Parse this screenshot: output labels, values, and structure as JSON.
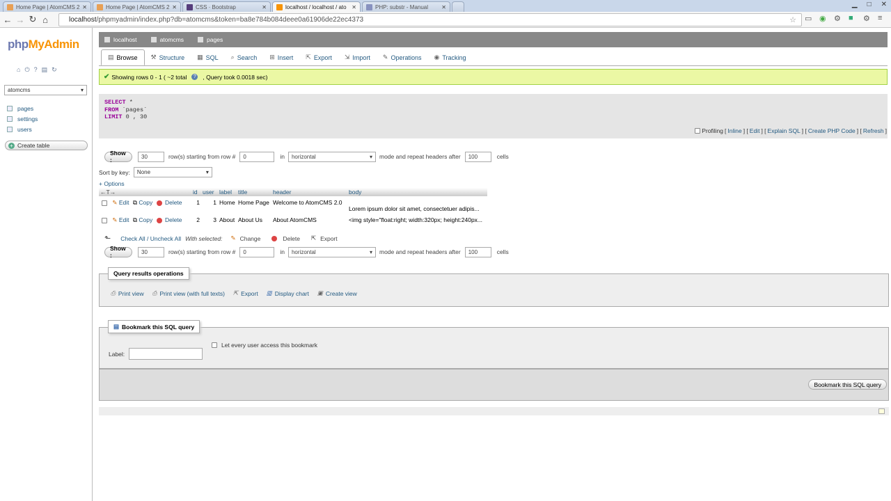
{
  "browser": {
    "tabs": [
      {
        "title": "Home Page | AtomCMS 2.",
        "favicon_color": "#e8a055",
        "active": false
      },
      {
        "title": "Home Page | AtomCMS 2.",
        "favicon_color": "#e8a055",
        "active": false
      },
      {
        "title": "CSS · Bootstrap",
        "favicon_color": "#563d7c",
        "active": false
      },
      {
        "title": "localhost / localhost / ato",
        "favicon_color": "#f89406",
        "active": true
      },
      {
        "title": "PHP: substr - Manual",
        "favicon_color": "#8892bf",
        "active": false
      }
    ],
    "url_host": "localhost",
    "url_rest": "/phpmyadmin/index.php?db=atomcms&token=ba8e784b084deee0a61906de22ec4373"
  },
  "sidebar": {
    "logo_php": "php",
    "logo_my": "MyAdmin",
    "db_selected": "atomcms",
    "tables": [
      "pages",
      "settings",
      "users"
    ],
    "create_table": "Create table"
  },
  "breadcrumb": {
    "server": "localhost",
    "db": "atomcms",
    "table": "pages"
  },
  "tabs": [
    "Browse",
    "Structure",
    "SQL",
    "Search",
    "Insert",
    "Export",
    "Import",
    "Operations",
    "Tracking"
  ],
  "success": {
    "text": "Showing rows 0 - 1 ( ~2 total",
    "query_time": ", Query took 0.0018 sec)"
  },
  "sql": {
    "select_kw": "SELECT",
    "select_val": " *",
    "from_kw": "FROM",
    "from_val": " `pages`",
    "limit_kw": "LIMIT",
    "limit_val": " 0 , 30"
  },
  "profiling": {
    "label": "Profiling",
    "links": [
      "Inline",
      "Edit",
      "Explain SQL",
      "Create PHP Code",
      "Refresh"
    ]
  },
  "nav": {
    "show": "Show :",
    "rows": "30",
    "rows_text": "row(s) starting from row #",
    "start": "0",
    "in": "in",
    "mode": "horizontal",
    "mode_text": "mode and repeat headers after",
    "repeat": "100",
    "cells": "cells"
  },
  "sort": {
    "label": "Sort by key:",
    "value": "None"
  },
  "options": "+ Options",
  "table": {
    "columns": [
      "id",
      "user",
      "label",
      "title",
      "header",
      "body"
    ],
    "rows": [
      {
        "id": "1",
        "user": "1",
        "label": "Home",
        "title": "Home Page",
        "header": "Welcome to AtomCMS 2.0",
        "body": "Lorem ipsum dolor sit amet, consectetuer adipis..."
      },
      {
        "id": "2",
        "user": "3",
        "label": "About",
        "title": "About Us",
        "header": "About AtomCMS",
        "body": "<img style=\"float:right; width:320px; height:240px..."
      }
    ],
    "actions": {
      "edit": "Edit",
      "copy": "Copy",
      "delete": "Delete"
    }
  },
  "bulk": {
    "check_all": "Check All / Uncheck All",
    "with_selected": "With selected:",
    "change": "Change",
    "delete": "Delete",
    "export": "Export"
  },
  "query_ops": {
    "legend": "Query results operations",
    "items": [
      "Print view",
      "Print view (with full texts)",
      "Export",
      "Display chart",
      "Create view"
    ]
  },
  "bookmark": {
    "legend": "Bookmark this SQL query",
    "label": "Label:",
    "check_text": "Let every user access this bookmark",
    "button": "Bookmark this SQL query"
  }
}
